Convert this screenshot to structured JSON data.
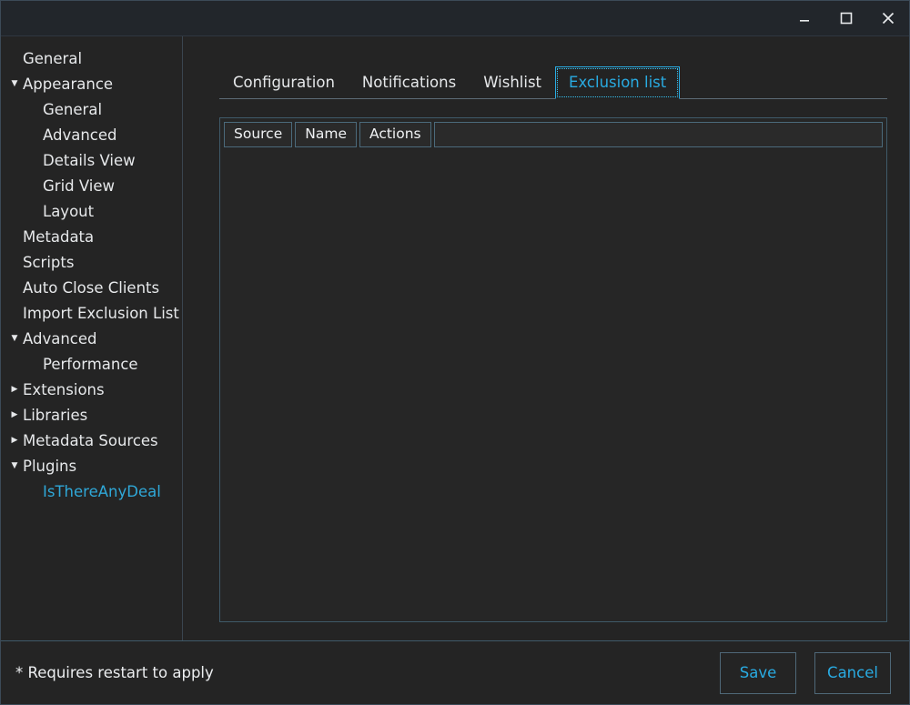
{
  "window": {
    "title": "",
    "controls": [
      {
        "name": "minimize",
        "label": "–"
      },
      {
        "name": "maximize",
        "label": "□"
      },
      {
        "name": "close",
        "label": "✕"
      }
    ]
  },
  "colors": {
    "background": "#242424",
    "titlebar": "#22262b",
    "accent": "#29abe2",
    "panel_border": "#3f5a69",
    "text": "#e6e8ea"
  },
  "sidebar": {
    "items": [
      {
        "label": "General",
        "level": 0,
        "arrow": "none",
        "selected": false
      },
      {
        "label": "Appearance",
        "level": 0,
        "arrow": "expanded",
        "selected": false
      },
      {
        "label": "General",
        "level": 1,
        "arrow": "none",
        "selected": false
      },
      {
        "label": "Advanced",
        "level": 1,
        "arrow": "none",
        "selected": false
      },
      {
        "label": "Details View",
        "level": 1,
        "arrow": "none",
        "selected": false
      },
      {
        "label": "Grid View",
        "level": 1,
        "arrow": "none",
        "selected": false
      },
      {
        "label": "Layout",
        "level": 1,
        "arrow": "none",
        "selected": false
      },
      {
        "label": "Metadata",
        "level": 0,
        "arrow": "none",
        "selected": false
      },
      {
        "label": "Scripts",
        "level": 0,
        "arrow": "none",
        "selected": false
      },
      {
        "label": "Auto Close Clients",
        "level": 0,
        "arrow": "none",
        "selected": false
      },
      {
        "label": "Import Exclusion List",
        "level": 0,
        "arrow": "none",
        "selected": false
      },
      {
        "label": "Advanced",
        "level": 0,
        "arrow": "expanded",
        "selected": false
      },
      {
        "label": "Performance",
        "level": 1,
        "arrow": "none",
        "selected": false
      },
      {
        "label": "Extensions",
        "level": 0,
        "arrow": "collapsed",
        "selected": false
      },
      {
        "label": "Libraries",
        "level": 0,
        "arrow": "collapsed",
        "selected": false
      },
      {
        "label": "Metadata Sources",
        "level": 0,
        "arrow": "collapsed",
        "selected": false
      },
      {
        "label": "Plugins",
        "level": 0,
        "arrow": "expanded",
        "selected": false
      },
      {
        "label": "IsThereAnyDeal",
        "level": 1,
        "arrow": "none",
        "selected": true
      }
    ]
  },
  "main": {
    "tabs": [
      {
        "label": "Configuration",
        "active": false
      },
      {
        "label": "Notifications",
        "active": false
      },
      {
        "label": "Wishlist",
        "active": false
      },
      {
        "label": "Exclusion list",
        "active": true
      }
    ],
    "table": {
      "columns": [
        "Source",
        "Name",
        "Actions",
        ""
      ],
      "rows": []
    }
  },
  "footer": {
    "note": "* Requires restart to apply",
    "save_label": "Save",
    "cancel_label": "Cancel"
  }
}
